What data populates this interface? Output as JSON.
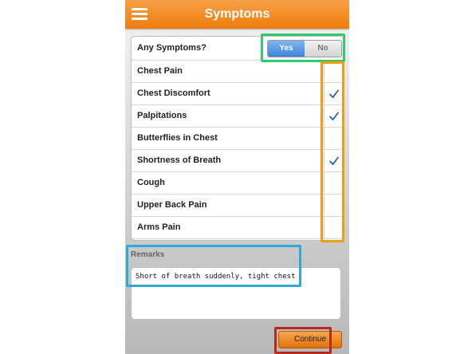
{
  "header": {
    "title": "Symptoms",
    "menu_icon": "hamburger-icon"
  },
  "any_symptoms": {
    "label": "Any Symptoms?",
    "yes_label": "Yes",
    "no_label": "No",
    "selected": "Yes"
  },
  "symptoms": [
    {
      "label": "Chest Pain",
      "checked": false
    },
    {
      "label": "Chest Discomfort",
      "checked": true
    },
    {
      "label": "Palpitations",
      "checked": true
    },
    {
      "label": "Butterflies in Chest",
      "checked": false
    },
    {
      "label": "Shortness of Breath",
      "checked": true
    },
    {
      "label": "Cough",
      "checked": false
    },
    {
      "label": "Upper Back Pain",
      "checked": false
    },
    {
      "label": "Arms Pain",
      "checked": false
    }
  ],
  "remarks": {
    "label": "Remarks",
    "value": "Short of breath suddenly, tight chest"
  },
  "continue_label": "Continue",
  "colors": {
    "header": "#ef7d0e",
    "toggle_active": "#3f83d8",
    "check": "#2f5fa8",
    "highlight_green": "#2ecc71",
    "highlight_orange": "#f39c12",
    "highlight_blue": "#2eaad6",
    "highlight_red": "#b52a1c"
  }
}
